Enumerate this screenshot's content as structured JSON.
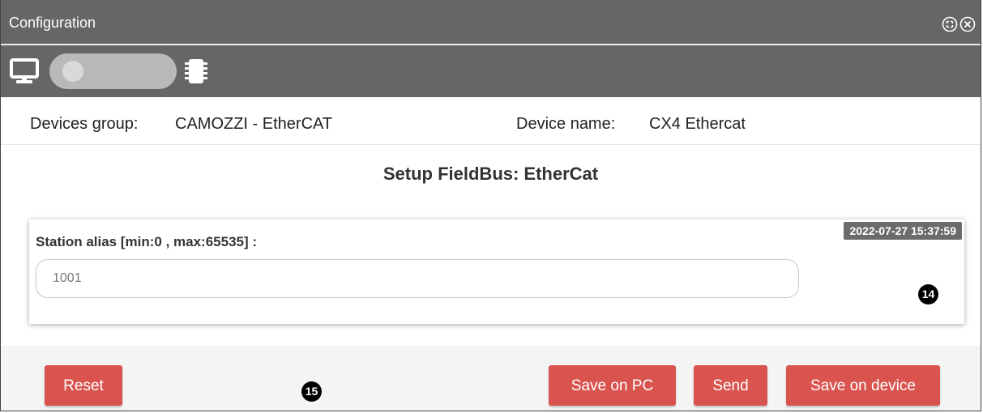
{
  "window": {
    "title": "Configuration",
    "icons": [
      "expand-icon",
      "close-circle-icon"
    ]
  },
  "toolbar": {
    "left_icon": "monitor-icon",
    "right_icon": "chip-icon",
    "toggle_state": "off"
  },
  "device_info": {
    "group_label": "Devices group:",
    "group_value": "CAMOZZI - EtherCAT",
    "name_label": "Device name:",
    "name_value": "CX4 Ethercat"
  },
  "section": {
    "title": "Setup FieldBus: EtherCat"
  },
  "station_alias": {
    "label": "Station alias [min:0 , max:65535] :",
    "value": "1001",
    "timestamp": "2022-07-27 15:37:59"
  },
  "markers": {
    "card_marker": "14",
    "footer_marker": "15"
  },
  "buttons": {
    "reset": "Reset",
    "save_pc": "Save on PC",
    "send": "Send",
    "save_device": "Save on device"
  },
  "colors": {
    "header_bg": "#666666",
    "button_red": "#d9534f"
  }
}
